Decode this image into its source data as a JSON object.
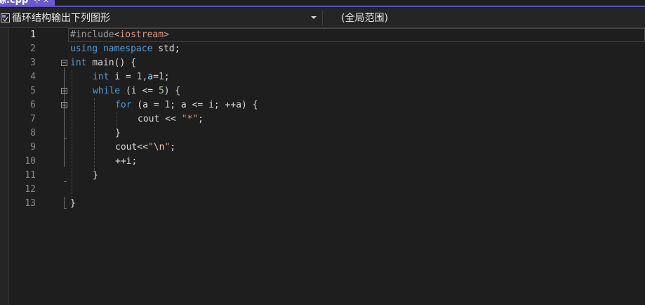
{
  "tab": {
    "label": "源.cpp",
    "glyph": "⊹  ✕"
  },
  "navbar": {
    "project": "循环结构输出下列图形",
    "scope": "(全局范围)"
  },
  "editor": {
    "line_numbers": [
      "1",
      "2",
      "3",
      "4",
      "5",
      "6",
      "7",
      "8",
      "9",
      "10",
      "11",
      "12",
      "13"
    ],
    "lines": [
      {
        "t1": "#include",
        "t2": "<iostream>"
      },
      {
        "k1": "using",
        "k2": "namespace",
        "t": " std;"
      },
      {
        "k": "int",
        "t": " main() {"
      },
      {
        "k": "int",
        "a": " i = ",
        "n1": "1",
        "b": ",",
        "v": "a",
        "c": "=",
        "n2": "1",
        "d": ";"
      },
      {
        "k": "while",
        "a": " (i <= ",
        "n": "5",
        "b": ") {"
      },
      {
        "k": "for",
        "a": " (a = ",
        "n": "1",
        "b": "; a <= i; ++a) {"
      },
      {
        "a": "cout << ",
        "s": "\"*\"",
        "b": ";"
      },
      {
        "t": "}"
      },
      {
        "a": "cout<<",
        "s1": "\"",
        "e": "\\n",
        "s2": "\"",
        "b": ";"
      },
      {
        "t": "++i;"
      },
      {
        "t": "}"
      },
      {
        "t": ""
      },
      {
        "t": "}"
      }
    ]
  }
}
